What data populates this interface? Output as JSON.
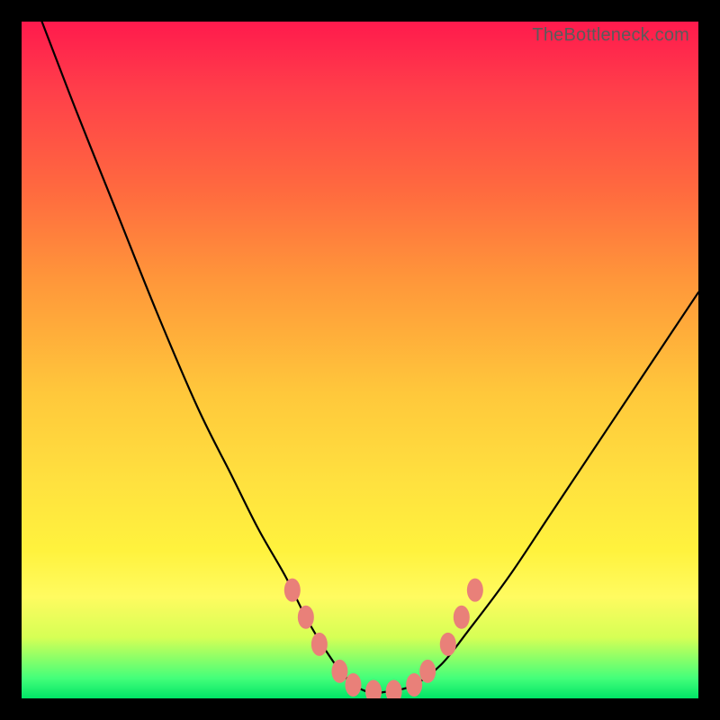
{
  "watermark": "TheBottleneck.com",
  "chart_data": {
    "type": "line",
    "title": "",
    "xlabel": "",
    "ylabel": "",
    "xlim": [
      0,
      100
    ],
    "ylim": [
      0,
      100
    ],
    "series": [
      {
        "name": "bottleneck-curve",
        "x": [
          3,
          8,
          14,
          20,
          26,
          31,
          35,
          39,
          42,
          45,
          48,
          51,
          54,
          58,
          62,
          66,
          72,
          78,
          84,
          90,
          96,
          100
        ],
        "y": [
          100,
          87,
          72,
          57,
          43,
          33,
          25,
          18,
          12,
          7,
          3,
          1,
          1,
          2,
          5,
          10,
          18,
          27,
          36,
          45,
          54,
          60
        ]
      },
      {
        "name": "highlight-dots",
        "x": [
          40,
          42,
          44,
          47,
          49,
          52,
          55,
          58,
          60,
          63,
          65,
          67
        ],
        "y": [
          16,
          12,
          8,
          4,
          2,
          1,
          1,
          2,
          4,
          8,
          12,
          16
        ]
      }
    ]
  }
}
